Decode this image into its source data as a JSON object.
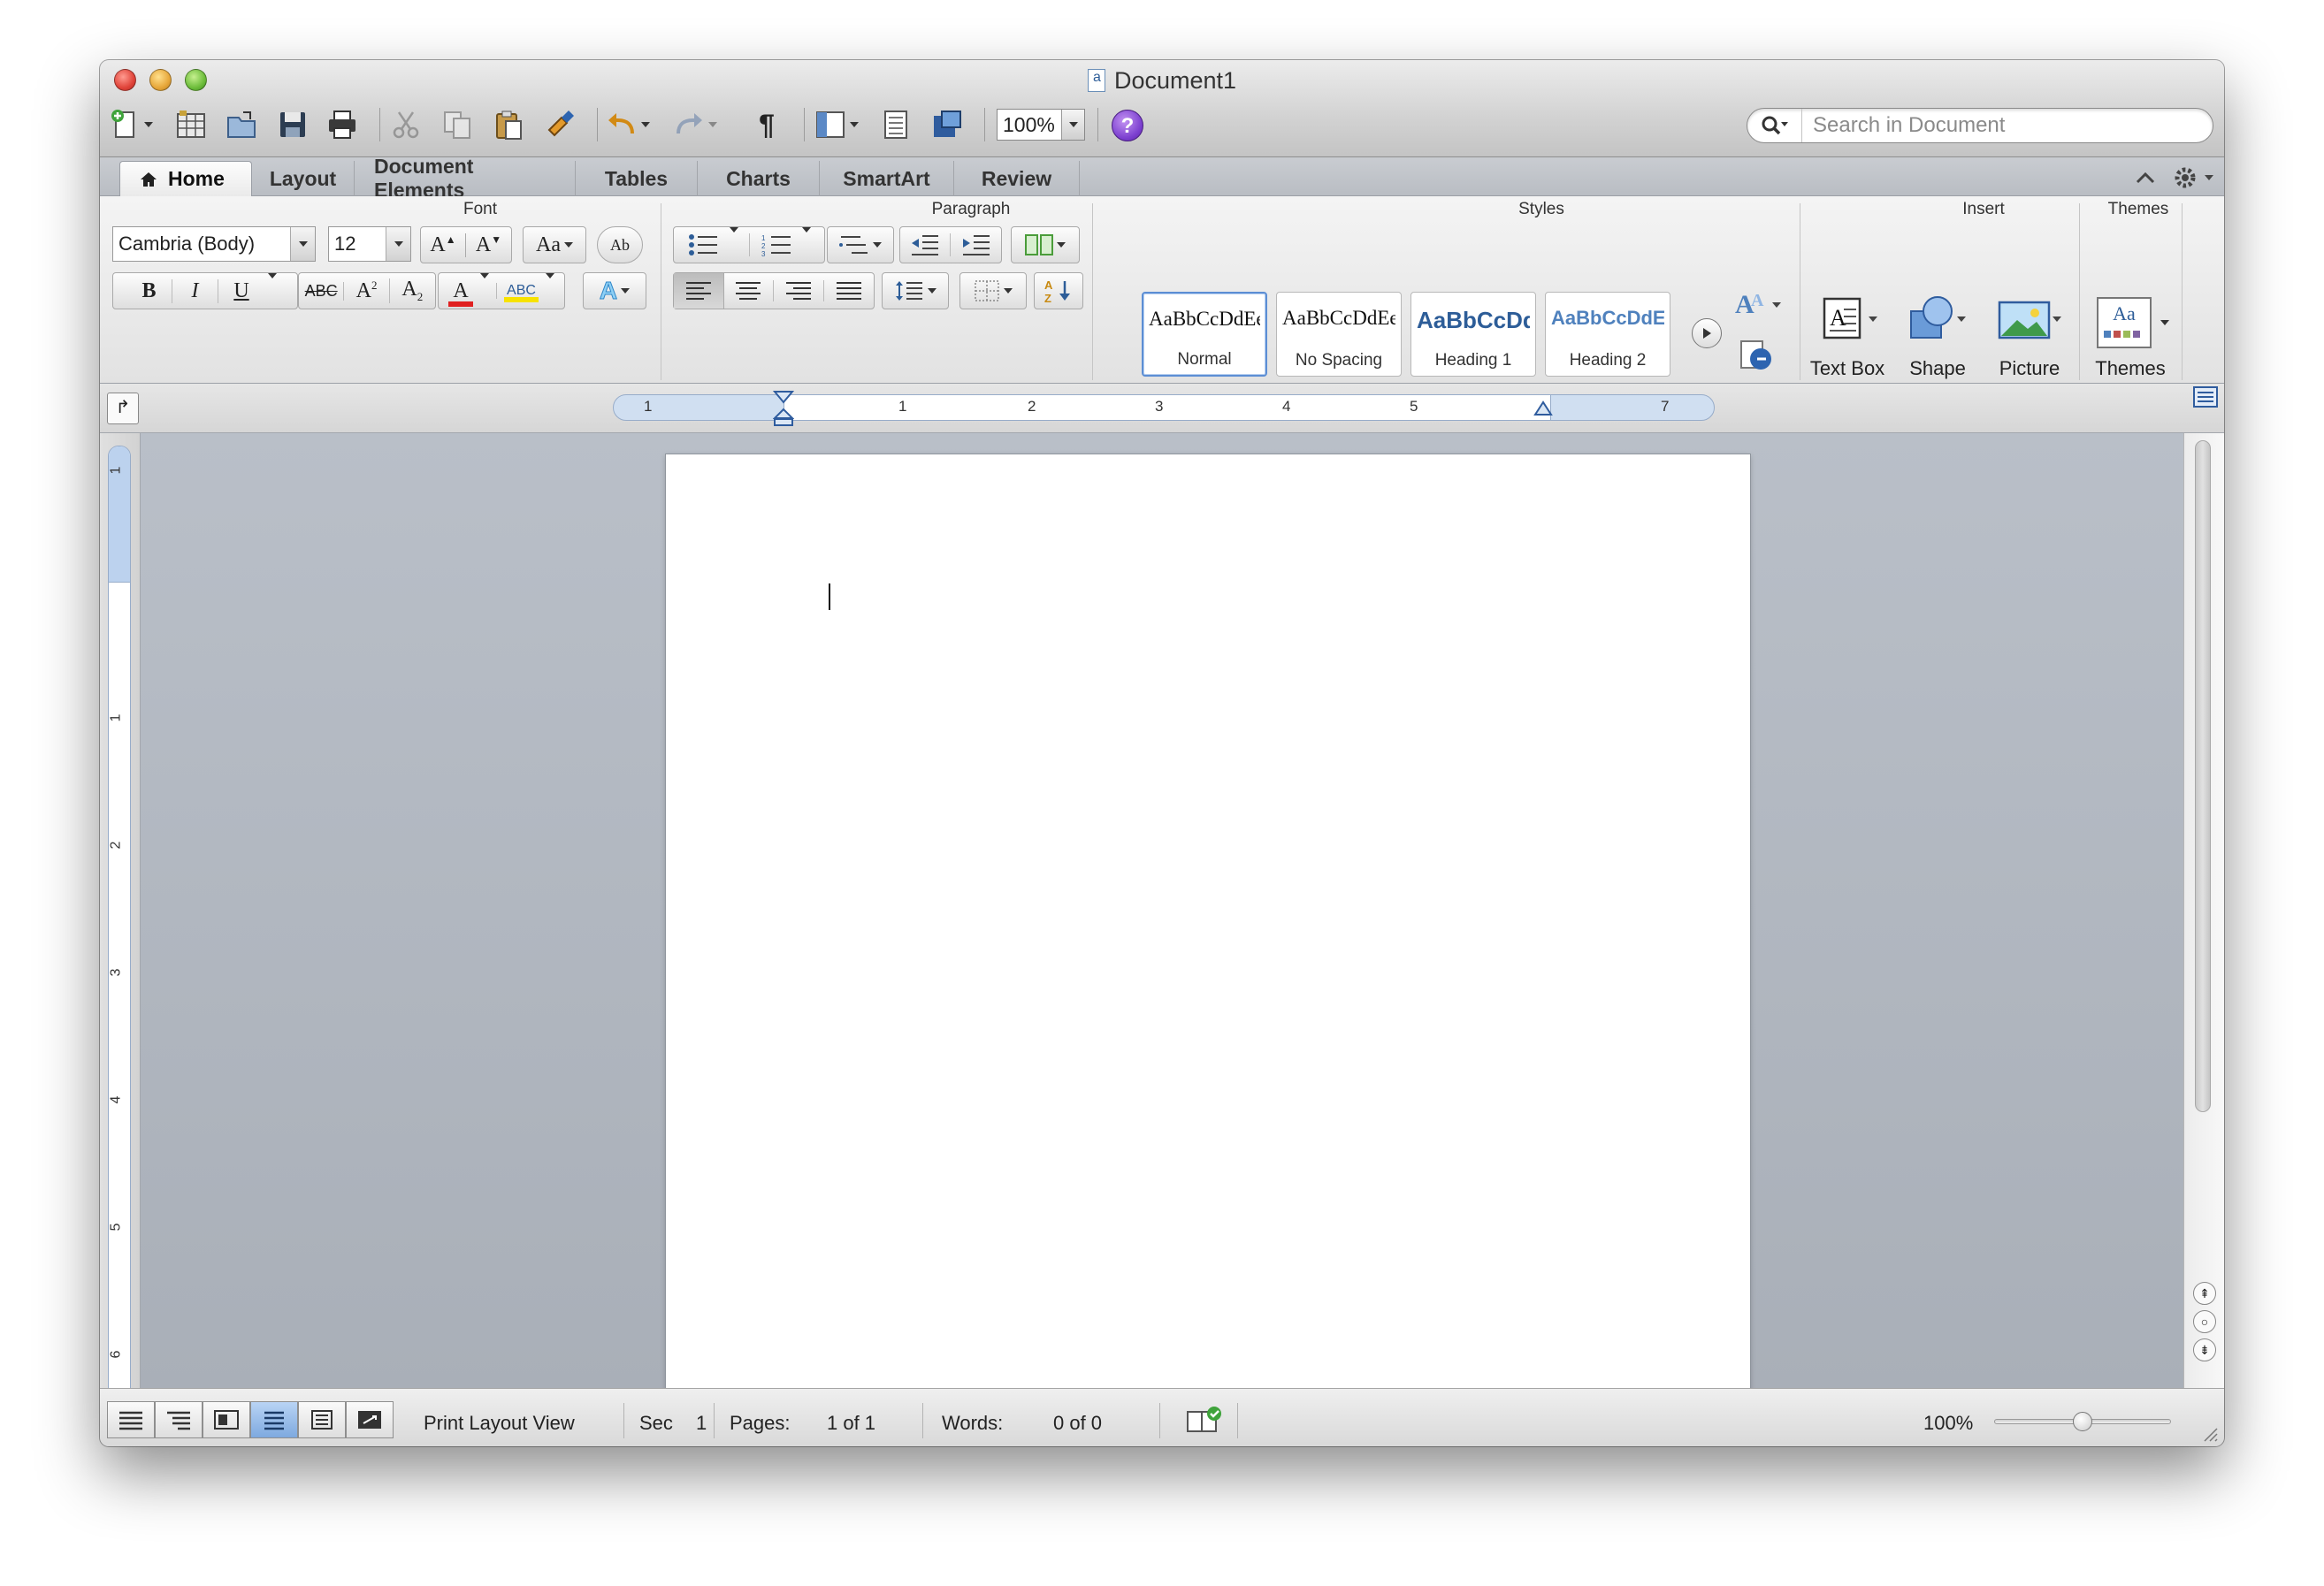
{
  "window": {
    "title": "Document1"
  },
  "toolbar": {
    "zoom_value": "100%",
    "help_label": "?",
    "search_placeholder": "Search in Document"
  },
  "ribbon_tabs": [
    {
      "label": "Home",
      "active": true
    },
    {
      "label": "Layout"
    },
    {
      "label": "Document Elements"
    },
    {
      "label": "Tables"
    },
    {
      "label": "Charts"
    },
    {
      "label": "SmartArt"
    },
    {
      "label": "Review"
    }
  ],
  "groups": {
    "font": "Font",
    "paragraph": "Paragraph",
    "styles": "Styles",
    "insert": "Insert",
    "themes": "Themes"
  },
  "font": {
    "family": "Cambria (Body)",
    "size": "12",
    "grow_label": "A",
    "shrink_label": "A",
    "case_label": "Aa",
    "bold": "B",
    "italic": "I",
    "underline": "U",
    "strike": "ABC",
    "superscript": "A",
    "subscript": "A",
    "font_color_label": "A",
    "highlight_label": "ABC",
    "effects_label": "A",
    "spell_label": "Ab"
  },
  "styles": [
    {
      "sample": "AaBbCcDdEe",
      "label": "Normal",
      "selected": true,
      "color": "#111111"
    },
    {
      "sample": "AaBbCcDdEe",
      "label": "No Spacing",
      "color": "#111111"
    },
    {
      "sample": "AaBbCcDd",
      "label": "Heading 1",
      "color": "#2d5d98"
    },
    {
      "sample": "AaBbCcDdEe",
      "label": "Heading 2",
      "color": "#4f81bd"
    }
  ],
  "insert": [
    {
      "label": "Text Box"
    },
    {
      "label": "Shape"
    },
    {
      "label": "Picture"
    }
  ],
  "themes": {
    "label": "Themes",
    "icon_text": "Aa"
  },
  "ruler": {
    "numbers": [
      "1",
      "1",
      "2",
      "3",
      "4",
      "5",
      "7"
    ]
  },
  "vruler": {
    "numbers": [
      "1",
      "1",
      "2",
      "3",
      "4",
      "5",
      "6"
    ]
  },
  "statusbar": {
    "view_name": "Print Layout View",
    "sec_label": "Sec",
    "sec_value": "1",
    "pages_label": "Pages:",
    "pages_value": "1 of 1",
    "words_label": "Words:",
    "words_value": "0 of 0",
    "zoom": "100%"
  },
  "colors": {
    "accent": "#5c8ed4",
    "font_color_bar": "#e02020",
    "highlight_bar": "#f7e200"
  }
}
